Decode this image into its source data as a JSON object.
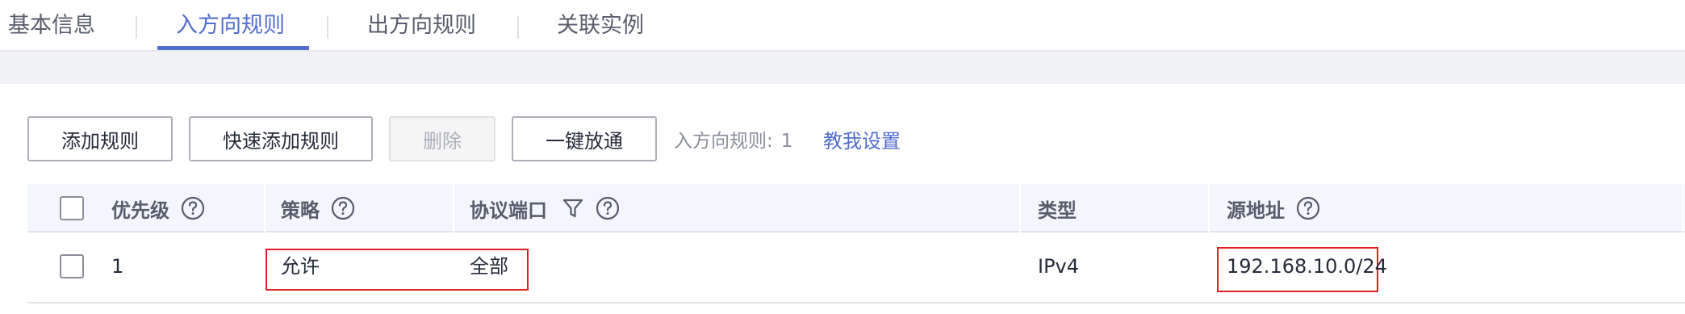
{
  "tabs": [
    {
      "label": "基本信息",
      "active": false
    },
    {
      "label": "入方向规则",
      "active": true
    },
    {
      "label": "出方向规则",
      "active": false
    },
    {
      "label": "关联实例",
      "active": false
    }
  ],
  "toolbar": {
    "add_rule": "添加规则",
    "quick_add_rule": "快速添加规则",
    "delete": "删除",
    "one_click_allow": "一键放通",
    "rule_count_label": "入方向规则:",
    "rule_count_value": "1",
    "help_link": "教我设置"
  },
  "table": {
    "columns": {
      "priority": "优先级",
      "policy": "策略",
      "protocol_port": "协议端口",
      "type": "类型",
      "source": "源地址"
    },
    "rows": [
      {
        "priority": "1",
        "policy": "允许",
        "protocol_port": "全部",
        "type": "IPv4",
        "source": "192.168.10.0/24"
      }
    ]
  },
  "colors": {
    "accent": "#526ecc",
    "highlight_border": "#e02020",
    "header_bg": "#f3f6fc"
  }
}
